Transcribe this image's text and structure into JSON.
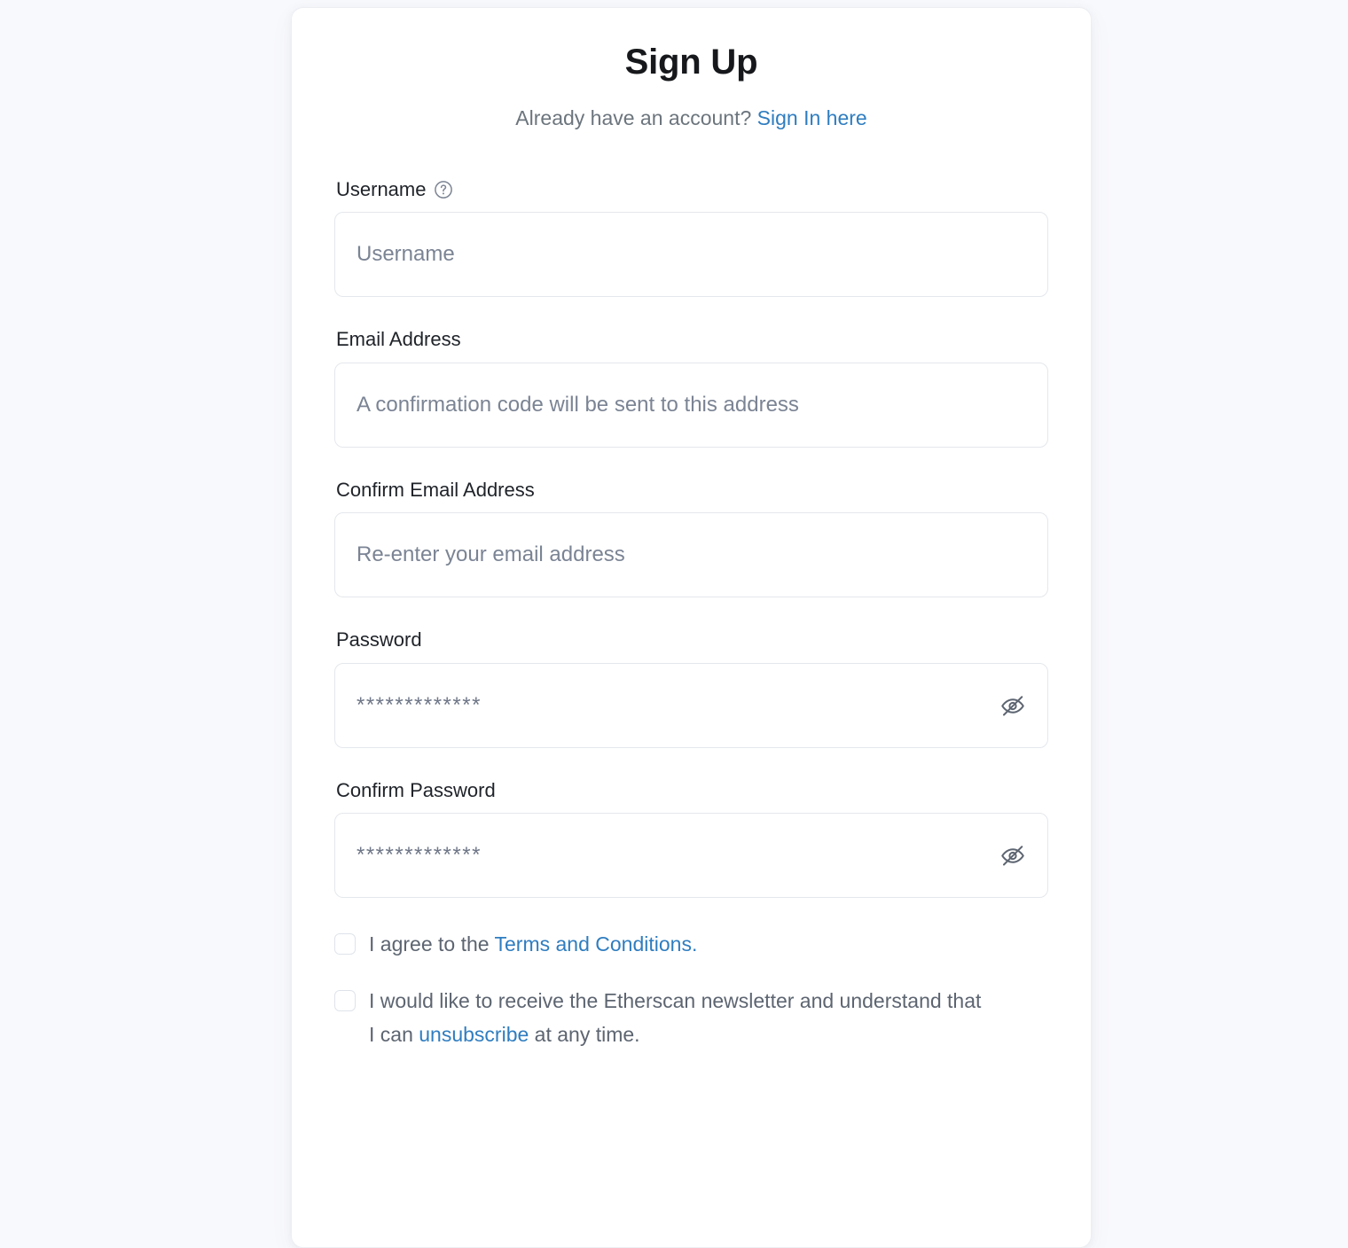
{
  "card": {
    "title": "Sign Up",
    "subtitle_prefix": "Already have an account?",
    "signin_link": "Sign In here"
  },
  "fields": {
    "username": {
      "label": "Username",
      "placeholder": "Username",
      "help_icon": "question-circle-icon",
      "value": ""
    },
    "email": {
      "label": "Email Address",
      "placeholder": "A confirmation code will be sent to this address",
      "value": ""
    },
    "confirm_email": {
      "label": "Confirm Email Address",
      "placeholder": "Re-enter your email address",
      "value": ""
    },
    "password": {
      "label": "Password",
      "placeholder": "*************",
      "value": "",
      "toggle_icon": "eye-off-icon"
    },
    "confirm_password": {
      "label": "Confirm Password",
      "placeholder": "*************",
      "value": "",
      "toggle_icon": "eye-off-icon"
    }
  },
  "agreements": {
    "terms": {
      "text_before": "I agree to the ",
      "link": "Terms and Conditions.",
      "checked": false
    },
    "newsletter": {
      "text_before": "I would like to receive the Etherscan newsletter and understand that I can ",
      "link": "unsubscribe",
      "text_after": " at any time.",
      "checked": false
    }
  },
  "colors": {
    "page_background": "#f8f9fc",
    "card_background": "#ffffff",
    "link": "#2f7dc0",
    "label": "#20242a",
    "muted_text": "#6c757d",
    "input_border": "#e4e7ec",
    "placeholder": "#7b8494"
  }
}
